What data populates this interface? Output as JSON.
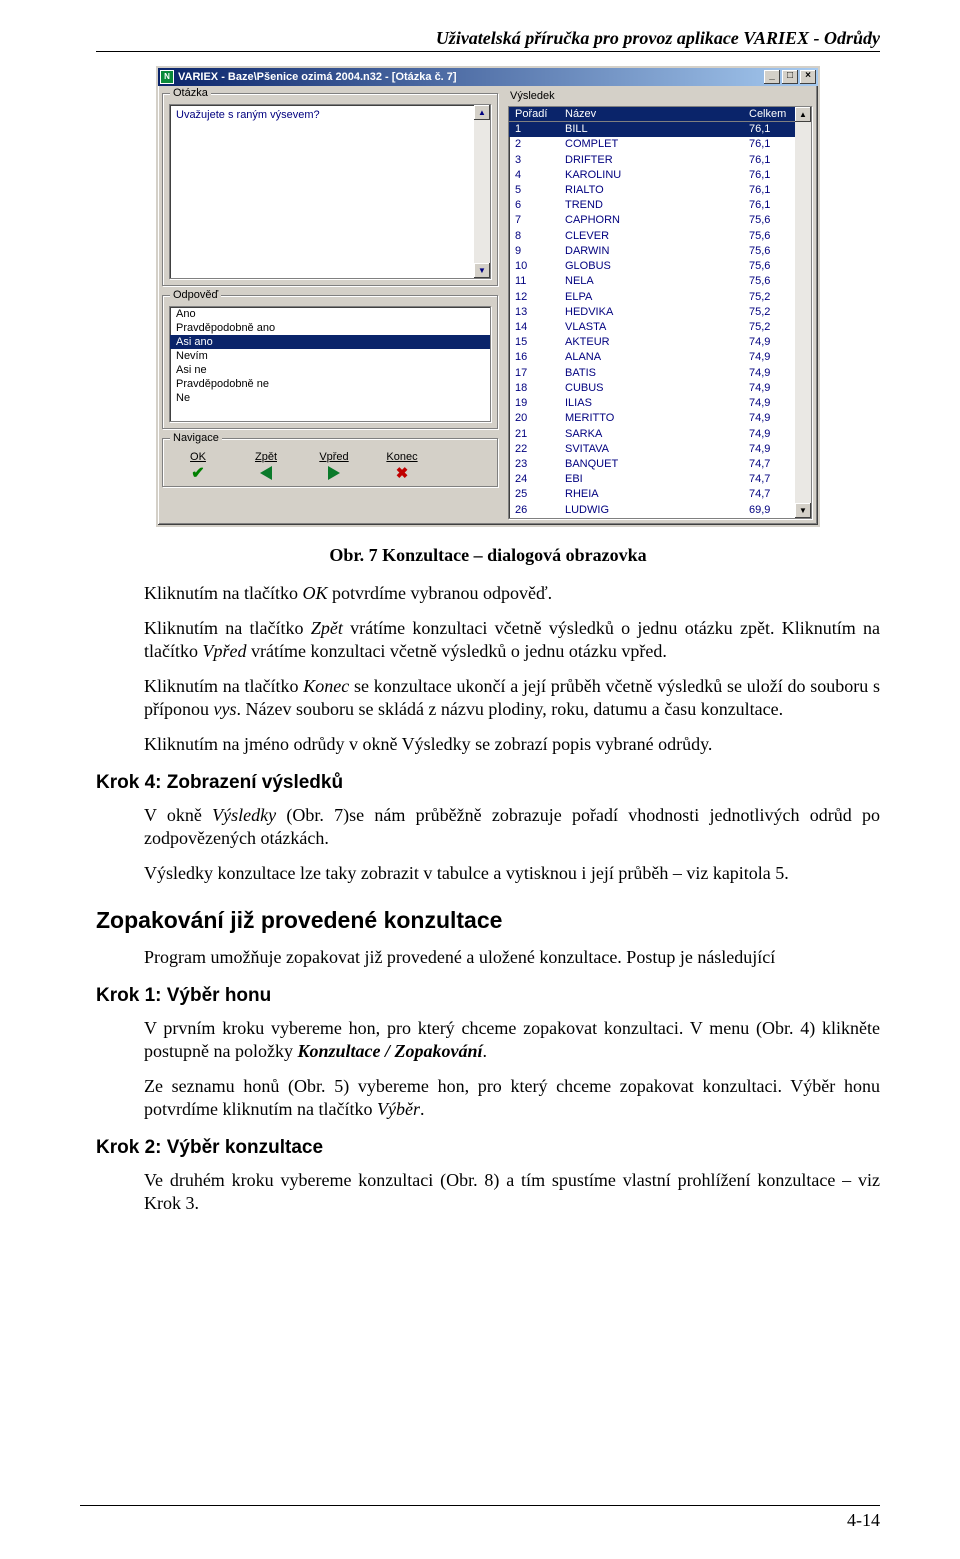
{
  "doc_header": "Uživatelská příručka pro provoz aplikace VARIEX - Odrůdy",
  "page_number": "4-14",
  "caption": "Obr. 7 Konzultace – dialogová obrazovka",
  "window": {
    "title": "VARIEX - Baze\\Pšenice ozimá 2004.n32 - [Otázka č. 7]",
    "min": "_",
    "max": "□",
    "close": "×",
    "group_labels": {
      "otazka": "Otázka",
      "odpoved": "Odpověď",
      "navigace": "Navigace",
      "vysledek": "Výsledek"
    },
    "question": "Uvažujete s raným výsevem?",
    "answers": [
      "Ano",
      "Pravděpodobně ano",
      "Asi ano",
      "Nevím",
      "Asi ne",
      "Pravděpodobně ne",
      "Ne"
    ],
    "answers_selected_index": 2,
    "nav": {
      "ok": "OK",
      "zpet": "Zpět",
      "vpred": "Vpřed",
      "konec": "Konec"
    },
    "result_headers": {
      "rank": "Pořadí",
      "name": "Název",
      "score": "Celkem"
    },
    "results": [
      {
        "rank": 1,
        "name": "BILL",
        "score": "76,1"
      },
      {
        "rank": 2,
        "name": "COMPLET",
        "score": "76,1"
      },
      {
        "rank": 3,
        "name": "DRIFTER",
        "score": "76,1"
      },
      {
        "rank": 4,
        "name": "KAROLINU",
        "score": "76,1"
      },
      {
        "rank": 5,
        "name": "RIALTO",
        "score": "76,1"
      },
      {
        "rank": 6,
        "name": "TREND",
        "score": "76,1"
      },
      {
        "rank": 7,
        "name": "CAPHORN",
        "score": "75,6"
      },
      {
        "rank": 8,
        "name": "CLEVER",
        "score": "75,6"
      },
      {
        "rank": 9,
        "name": "DARWIN",
        "score": "75,6"
      },
      {
        "rank": 10,
        "name": "GLOBUS",
        "score": "75,6"
      },
      {
        "rank": 11,
        "name": "NELA",
        "score": "75,6"
      },
      {
        "rank": 12,
        "name": "ELPA",
        "score": "75,2"
      },
      {
        "rank": 13,
        "name": "HEDVIKA",
        "score": "75,2"
      },
      {
        "rank": 14,
        "name": "VLASTA",
        "score": "75,2"
      },
      {
        "rank": 15,
        "name": "AKTEUR",
        "score": "74,9"
      },
      {
        "rank": 16,
        "name": "ALANA",
        "score": "74,9"
      },
      {
        "rank": 17,
        "name": "BATIS",
        "score": "74,9"
      },
      {
        "rank": 18,
        "name": "CUBUS",
        "score": "74,9"
      },
      {
        "rank": 19,
        "name": "ILIAS",
        "score": "74,9"
      },
      {
        "rank": 20,
        "name": "MERITTO",
        "score": "74,9"
      },
      {
        "rank": 21,
        "name": "SARKA",
        "score": "74,9"
      },
      {
        "rank": 22,
        "name": "SVITAVA",
        "score": "74,9"
      },
      {
        "rank": 23,
        "name": "BANQUET",
        "score": "74,7"
      },
      {
        "rank": 24,
        "name": "EBI",
        "score": "74,7"
      },
      {
        "rank": 25,
        "name": "RHEIA",
        "score": "74,7"
      },
      {
        "rank": 26,
        "name": "LUDWIG",
        "score": "69,9"
      }
    ]
  },
  "text": {
    "p1a": "Kliknutím na tlačítko ",
    "p1b": "OK",
    "p1c": " potvrdíme vybranou odpověď.",
    "p2a": "Kliknutím na tlačítko ",
    "p2b": "Zpět",
    "p2c": " vrátíme konzultaci včetně výsledků o jednu otázku zpět. Kliknutím na tlačítko ",
    "p2d": "Vpřed",
    "p2e": " vrátíme konzultaci včetně výsledků o jednu otázku vpřed.",
    "p3a": "Kliknutím na tlačítko ",
    "p3b": "Konec",
    "p3c": " se konzultace ukončí a její průběh včetně výsledků se uloží do souboru s příponou ",
    "p3d": "vys",
    "p3e": ". Název souboru se skládá z názvu plodiny, roku, datumu a času konzultace.",
    "p4": "Kliknutím na jméno odrůdy v okně Výsledky se zobrazí popis vybrané odrůdy.",
    "step4": "Krok 4: Zobrazení výsledků",
    "p5a": "V okně ",
    "p5b": "Výsledky",
    "p5c": " (Obr. 7)se nám průběžně zobrazuje pořadí vhodnosti jednotlivých odrůd po zodpovězených otázkách.",
    "p6": "Výsledky konzultace lze taky zobrazit v tabulce a vytisknou i její průběh – viz kapitola 5.",
    "section": "Zopakování již provedené konzultace",
    "p7": "Program umožňuje zopakovat již provedené a uložené konzultace. Postup je následující",
    "step1": "Krok 1: Výběr honu",
    "p8a": "V prvním kroku vybereme hon, pro který chceme zopakovat konzultaci. V menu (Obr. 4) klikněte postupně na položky ",
    "p8b": "Konzultace / Zopakování",
    "p8c": ".",
    "p9a": "Ze seznamu honů (Obr. 5) vybereme hon, pro který chceme zopakovat konzultaci. Výběr honu potvrdíme kliknutím na tlačítko ",
    "p9b": "Výběr",
    "p9c": ".",
    "step2": "Krok 2: Výběr konzultace",
    "p10": "Ve druhém kroku vybereme konzultaci (Obr. 8) a tím spustíme vlastní prohlížení konzultace – viz Krok 3."
  }
}
